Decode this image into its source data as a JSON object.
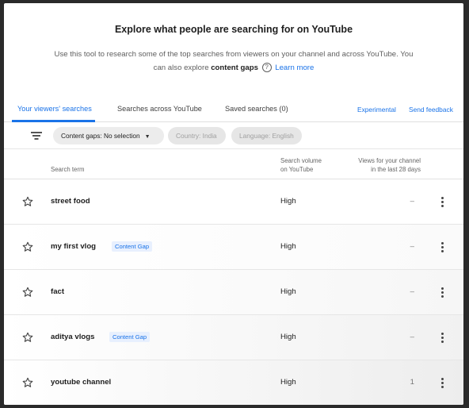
{
  "header": {
    "title": "Explore what people are searching for on YouTube",
    "description_part1": "Use this tool to research some of the top searches from viewers on your channel and across YouTube. You can also explore",
    "description_bold": "content gaps",
    "help_glyph": "?",
    "learn_more": "Learn more"
  },
  "tabs": [
    {
      "label": "Your viewers' searches",
      "active": true
    },
    {
      "label": "Searches across YouTube",
      "active": false
    },
    {
      "label": "Saved searches (0)",
      "active": false
    }
  ],
  "links": {
    "experimental": "Experimental",
    "feedback": "Send feedback"
  },
  "filters": {
    "content_gaps": "Content gaps: No selection",
    "country": "Country: India",
    "language": "Language: English"
  },
  "columns": {
    "term": "Search term",
    "volume_line1": "Search volume",
    "volume_line2": "on YouTube",
    "views_line1": "Views for your channel",
    "views_line2": "in the last 28 days"
  },
  "rows": [
    {
      "term": "street food",
      "badge": "",
      "volume": "High",
      "views": "–"
    },
    {
      "term": "my first vlog",
      "badge": "Content Gap",
      "volume": "High",
      "views": "–"
    },
    {
      "term": "fact",
      "badge": "",
      "volume": "High",
      "views": "–"
    },
    {
      "term": "aditya vlogs",
      "badge": "Content Gap",
      "volume": "High",
      "views": "–"
    },
    {
      "term": "youtube channel",
      "badge": "",
      "volume": "High",
      "views": "1"
    }
  ],
  "colors": {
    "accent": "#1a73e8",
    "badge_bg": "#e8f0fe",
    "backdrop": "#2a2a2a"
  },
  "icons": [
    "help-icon",
    "filter-icon",
    "chevron-down-icon",
    "star-outline-icon",
    "more-vert-icon"
  ]
}
